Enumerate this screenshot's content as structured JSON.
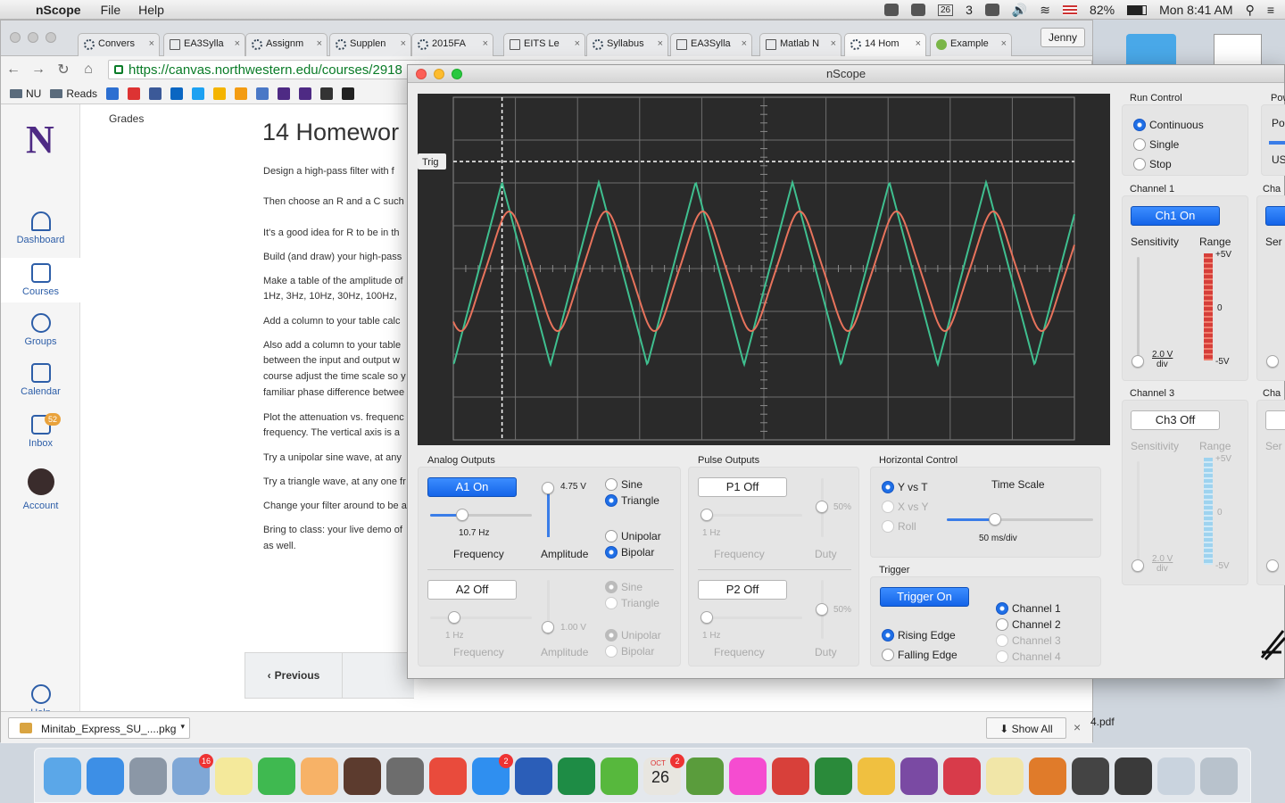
{
  "menubar": {
    "app": "nScope",
    "menus": [
      "File",
      "Help"
    ],
    "battery": "82%",
    "clock": "Mon 8:41 AM",
    "calendar_day": "26",
    "adobe_count": "3"
  },
  "browser": {
    "tabs": [
      "Convers",
      "EA3Sylla",
      "Assignm",
      "Supplen",
      "2015FA",
      "EITS Le",
      "Syllabus",
      "EA3Sylla",
      "Matlab N",
      "14 Hom",
      "Example"
    ],
    "profile": "Jenny",
    "url": "https://canvas.northwestern.edu/courses/2918",
    "bookmarks": [
      "NU",
      "Reads"
    ]
  },
  "canvas": {
    "logo": "N",
    "nav": [
      "Dashboard",
      "Courses",
      "Groups",
      "Calendar",
      "Inbox",
      "Account",
      "Help"
    ],
    "inbox_badge": "52",
    "grades": "Grades",
    "title": "14 Homewor",
    "paragraphs": [
      "Design a high-pass filter with f",
      "Then choose an R and a C such",
      "It's a good idea for R to be in th",
      "Build (and draw) your high-pass",
      "Make a table of the amplitude of",
      "1Hz, 3Hz, 10Hz, 30Hz, 100Hz,",
      "Add a column to your table calc",
      "Also add a column to your table",
      "between the input and output w",
      "course adjust the time scale so y",
      "familiar phase difference betwee",
      "Plot the attenuation vs. frequenc",
      "frequency.  The vertical axis is a",
      "Try a unipolar sine wave, at any",
      "Try a triangle wave, at any one fr",
      "Change your filter around to be a",
      "Bring to class: your live demo of",
      "as well."
    ],
    "previous": "Previous"
  },
  "downloads": {
    "file": "Minitab_Express_SU_....pkg",
    "show_all": "Show All",
    "pdf": "4.pdf"
  },
  "nscope": {
    "title": "nScope",
    "trig_label": "Trig",
    "trace_colors": {
      "ch1": "#e8735c",
      "a1": "#3fbf8f"
    },
    "analog": {
      "title": "Analog Outputs",
      "a1_button": "A1 On",
      "a1_freq": "10.7 Hz",
      "a1_freq_fraction": 0.32,
      "a1_amp": "4.75 V",
      "a1_amp_fraction": 0.95,
      "a2_button": "A2 Off",
      "a2_freq": "1 Hz",
      "a2_amp": "1.00 V",
      "frequency_label": "Frequency",
      "amplitude_label": "Amplitude",
      "sine": "Sine",
      "triangle": "Triangle",
      "unipolar": "Unipolar",
      "bipolar": "Bipolar"
    },
    "pulse": {
      "title": "Pulse Outputs",
      "p1_button": "P1 Off",
      "p2_button": "P2 Off",
      "freq": "1 Hz",
      "duty": "50%",
      "frequency_label": "Frequency",
      "duty_label": "Duty"
    },
    "horizontal": {
      "title": "Horizontal Control",
      "y_vs_t": "Y vs T",
      "x_vs_y": "X vs Y",
      "roll": "Roll",
      "time_scale_label": "Time Scale",
      "time_scale": "50 ms/div",
      "time_scale_fraction": 0.33
    },
    "trigger": {
      "title": "Trigger",
      "button": "Trigger On",
      "rising": "Rising Edge",
      "falling": "Falling Edge",
      "channels": [
        "Channel 1",
        "Channel 2",
        "Channel 3",
        "Channel 4"
      ]
    },
    "run": {
      "title": "Run Control",
      "options": [
        "Continuous",
        "Single",
        "Stop"
      ]
    },
    "ch1": {
      "title": "Channel 1",
      "button": "Ch1 On",
      "sensitivity": "Sensitivity",
      "range": "Range",
      "div": "2.0 V",
      "div_unit": "div",
      "ticks": [
        "+5V",
        "0",
        "-5V"
      ]
    },
    "ch3": {
      "title": "Channel 3",
      "button": "Ch3 Off",
      "sensitivity": "Sensitivity",
      "range": "Range",
      "div": "2.0 V",
      "div_unit": "div",
      "ticks": [
        "+5V",
        "0",
        "-5V"
      ]
    },
    "cut": {
      "power": "Pow",
      "po": "Po",
      "us": "US",
      "cha": "Cha",
      "ser": "Ser"
    }
  },
  "dock": {
    "badges": {
      "mail": "16",
      "appstore": "2",
      "calendar": "2"
    },
    "calendar_month": "OCT",
    "calendar_day": "26"
  }
}
